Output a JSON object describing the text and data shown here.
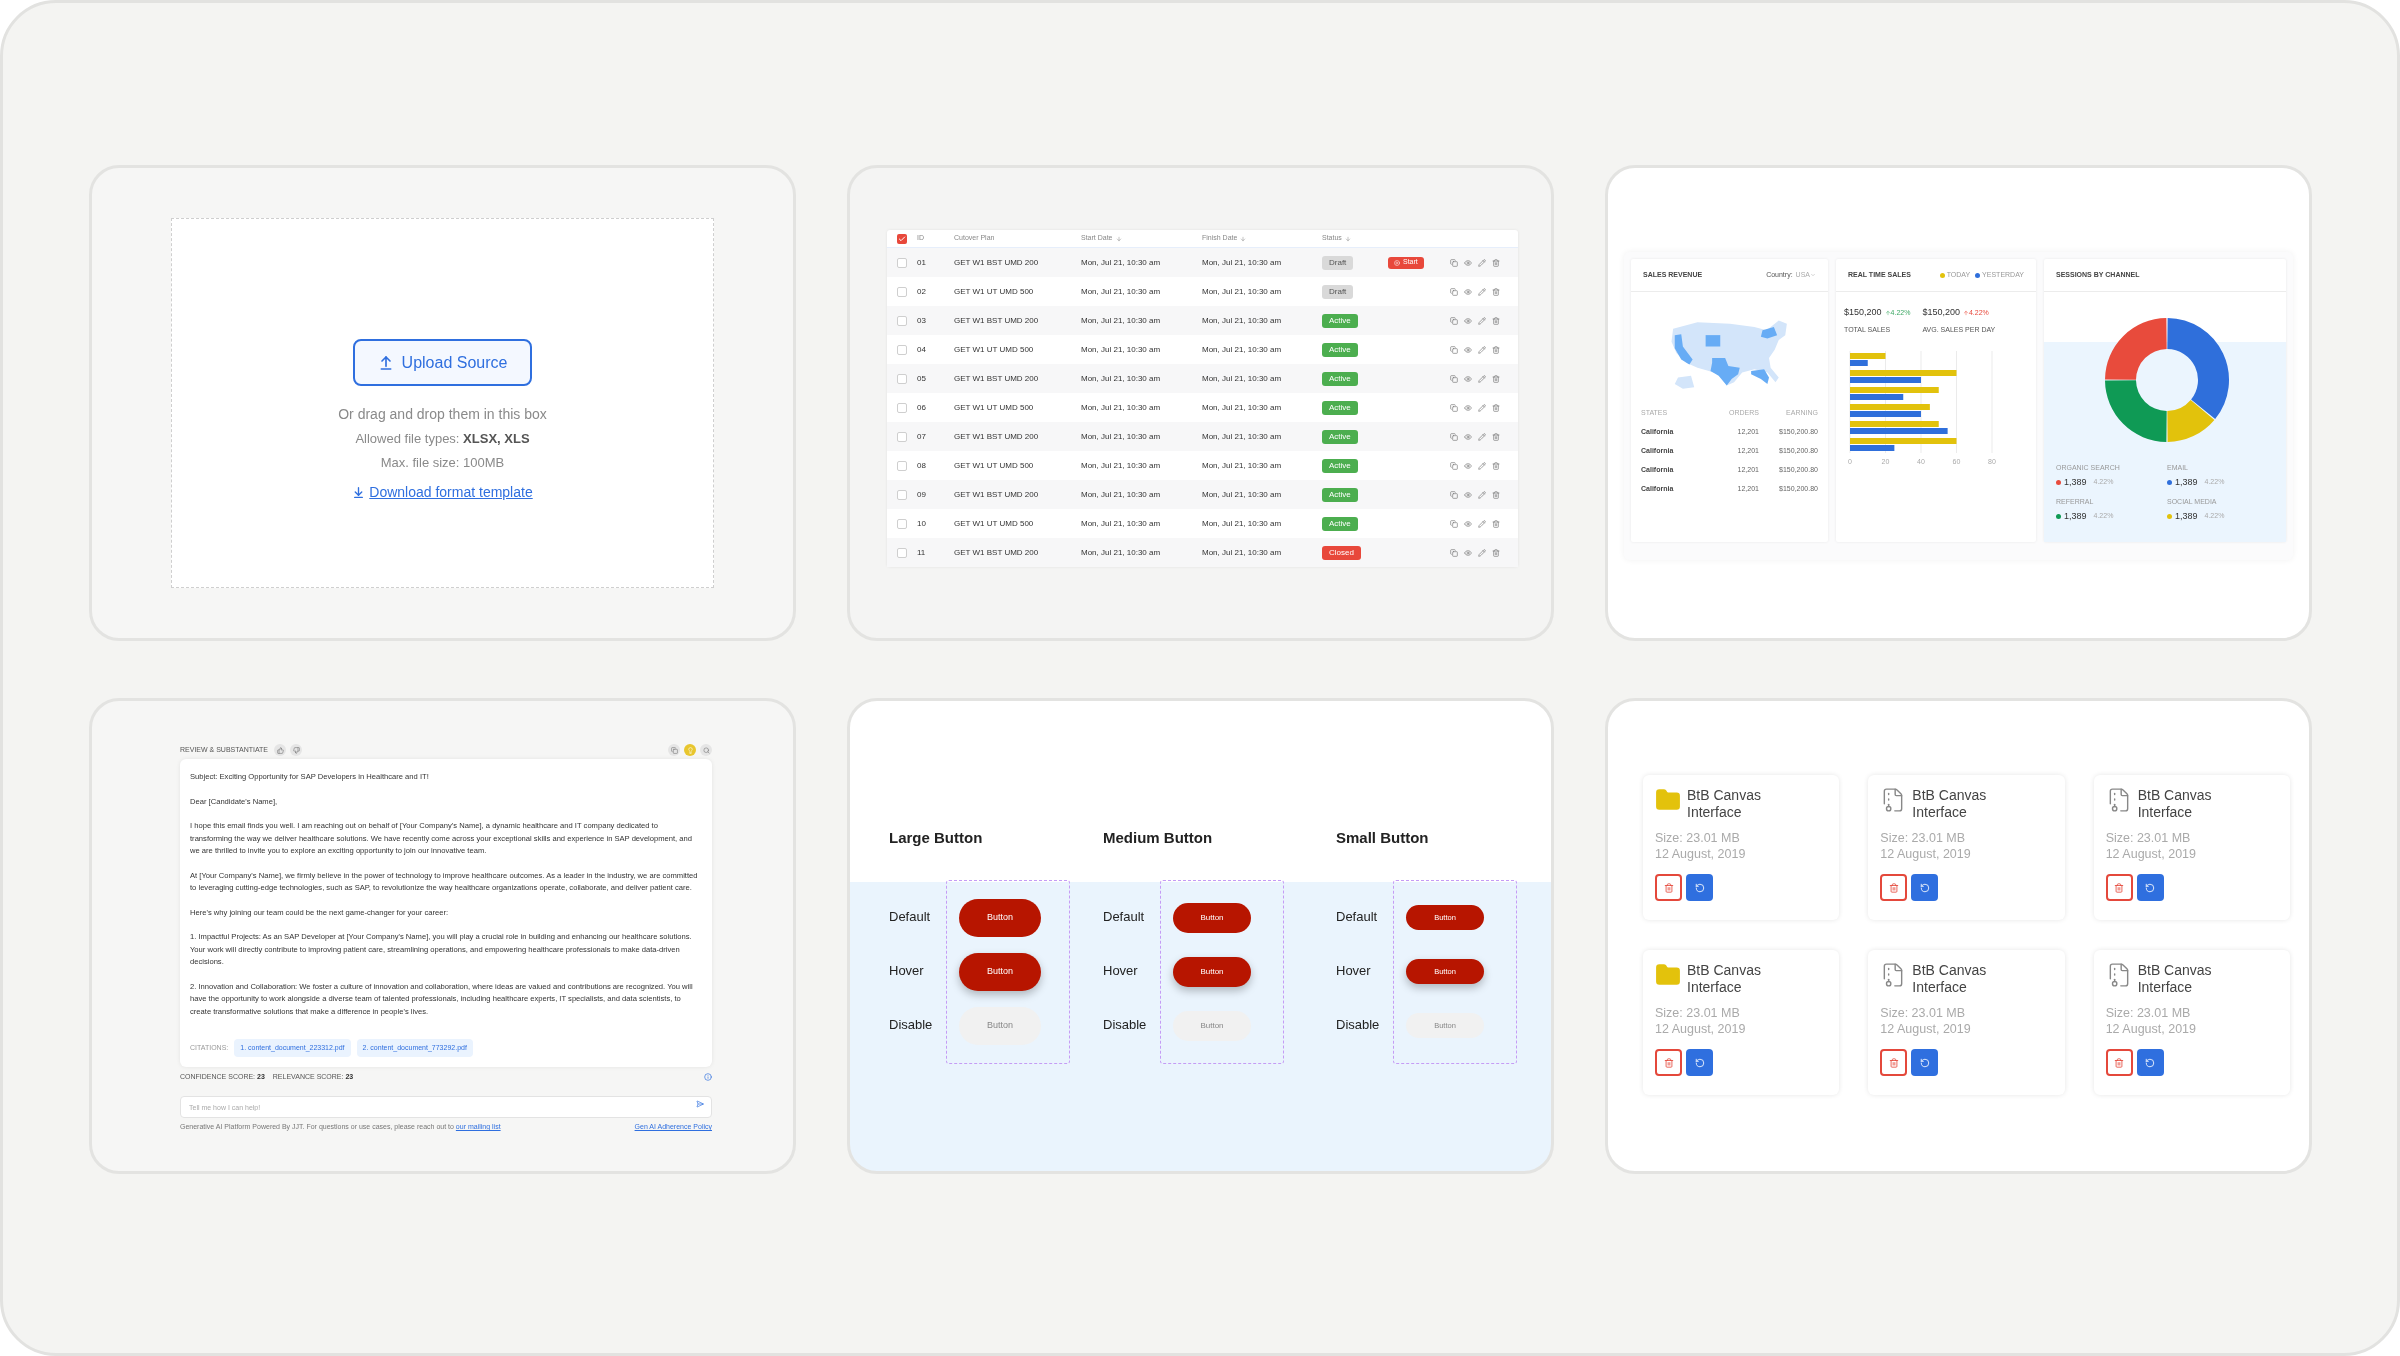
{
  "upload": {
    "button": "Upload Source",
    "hint": "Or drag and drop them in this box",
    "types": "Allowed file types: **XLSX, XLS**",
    "size": "Max. file size: 100MB",
    "link": "Download format template"
  },
  "table": {
    "header_checked": true,
    "columns": [
      {
        "label": "ID",
        "sortable": false
      },
      {
        "label": "Cutover Plan",
        "sortable": false
      },
      {
        "label": "Start Date",
        "sortable": true
      },
      {
        "label": "Finish Date",
        "sortable": true
      },
      {
        "label": "Status",
        "sortable": true
      }
    ],
    "rows": [
      {
        "checked": false,
        "id": "01",
        "plan": "GET W1 BST UMD 200",
        "start": "Mon, Jul 21, 10:30 am",
        "finish": "Mon, Jul 21, 10:30 am",
        "status": "Draft",
        "color": "#d9d9d9",
        "action": "Start"
      },
      {
        "checked": false,
        "id": "02",
        "plan": "GET W1 UT UMD 500",
        "start": "Mon, Jul 21, 10:30 am",
        "finish": "Mon, Jul 21, 10:30 am",
        "status": "Draft",
        "color": "#d9d9d9"
      },
      {
        "checked": false,
        "id": "03",
        "plan": "GET W1 BST UMD 200",
        "start": "Mon, Jul 21, 10:30 am",
        "finish": "Mon, Jul 21, 10:30 am",
        "status": "Active",
        "color": "#4cae4f"
      },
      {
        "checked": false,
        "id": "04",
        "plan": "GET W1 UT UMD 500",
        "start": "Mon, Jul 21, 10:30 am",
        "finish": "Mon, Jul 21, 10:30 am",
        "status": "Active",
        "color": "#4cae4f"
      },
      {
        "checked": false,
        "id": "05",
        "plan": "GET W1 BST UMD 200",
        "start": "Mon, Jul 21, 10:30 am",
        "finish": "Mon, Jul 21, 10:30 am",
        "status": "Active",
        "color": "#4cae4f"
      },
      {
        "checked": false,
        "id": "06",
        "plan": "GET W1 UT UMD 500",
        "start": "Mon, Jul 21, 10:30 am",
        "finish": "Mon, Jul 21, 10:30 am",
        "status": "Active",
        "color": "#4cae4f"
      },
      {
        "checked": false,
        "id": "07",
        "plan": "GET W1 BST UMD 200",
        "start": "Mon, Jul 21, 10:30 am",
        "finish": "Mon, Jul 21, 10:30 am",
        "status": "Active",
        "color": "#4cae4f"
      },
      {
        "checked": false,
        "id": "08",
        "plan": "GET W1 UT UMD 500",
        "start": "Mon, Jul 21, 10:30 am",
        "finish": "Mon, Jul 21, 10:30 am",
        "status": "Active",
        "color": "#4cae4f"
      },
      {
        "checked": false,
        "id": "09",
        "plan": "GET W1 BST UMD 200",
        "start": "Mon, Jul 21, 10:30 am",
        "finish": "Mon, Jul 21, 10:30 am",
        "status": "Active",
        "color": "#4cae4f"
      },
      {
        "checked": false,
        "id": "10",
        "plan": "GET W1 UT UMD 500",
        "start": "Mon, Jul 21, 10:30 am",
        "finish": "Mon, Jul 21, 10:30 am",
        "status": "Active",
        "color": "#4cae4f"
      },
      {
        "checked": false,
        "id": "11",
        "plan": "GET W1 BST UMD 200",
        "start": "Mon, Jul 21, 10:30 am",
        "finish": "Mon, Jul 21, 10:30 am",
        "status": "Closed",
        "color": "#e8483b"
      }
    ]
  },
  "dashboard": {
    "sales_revenue": {
      "title": "SALES REVENUE",
      "country_label": "Country:",
      "country": "USA",
      "columns": [
        "STATES",
        "ORDERS",
        "EARNING"
      ],
      "rows": [
        {
          "state": "California",
          "orders": "12,201",
          "earning": "$150,200.80"
        },
        {
          "state": "California",
          "orders": "12,201",
          "earning": "$150,200.80"
        },
        {
          "state": "California",
          "orders": "12,201",
          "earning": "$150,200.80"
        },
        {
          "state": "California",
          "orders": "12,201",
          "earning": "$150,200.80"
        }
      ]
    },
    "real_time_sales": {
      "title": "REAL TIME SALES",
      "stats": [
        {
          "value": "$150,200",
          "change": "4.22%",
          "positive": true,
          "label": "TOTAL SALES"
        },
        {
          "value": "$150,200",
          "change": "4.22%",
          "positive": false,
          "label": "AVG. SALES PER DAY"
        }
      ],
      "chart_data": {
        "type": "bar",
        "orientation": "horizontal",
        "grid": true,
        "xlim": [
          0,
          80
        ],
        "xticks": [
          0,
          20,
          40,
          60,
          80
        ],
        "series": [
          {
            "name": "TODAY",
            "color": "#e2c20c",
            "values": [
              20,
              60,
              50,
              45,
              50,
              60
            ]
          },
          {
            "name": "YESTERDAY",
            "color": "#2f6fdb",
            "values": [
              10,
              40,
              30,
              40,
              55,
              25
            ]
          }
        ]
      }
    },
    "sessions": {
      "title": "SESSIONS BY CHANNEL",
      "channels": [
        {
          "label": "ORGANIC SEARCH",
          "value": "1,389",
          "change": "4.22%",
          "color": "#e84b3c"
        },
        {
          "label": "EMAIL",
          "value": "1,389",
          "change": "4.22%",
          "color": "#2f6fdb"
        },
        {
          "label": "REFERRAL",
          "value": "1,389",
          "change": "4.22%",
          "color": "#0f9a55"
        },
        {
          "label": "SOCIAL MEDIA",
          "value": "1,389",
          "change": "4.22%",
          "color": "#e2c20c"
        }
      ]
    }
  },
  "assistant": {
    "title": "REVIEW & SUBSTANTIATE",
    "paragraphs": [
      "Subject: Exciting Opportunity for SAP Developers in Healthcare and IT!",
      "Dear [Candidate's Name],",
      "I hope this email finds you well. I am reaching out on behalf of [Your Company's Name], a dynamic healthcare and IT company dedicated to transforming the way we deliver healthcare solutions. We have recently come across your exceptional skills and experience in SAP development, and we are thrilled to invite you to explore an exciting opportunity to join our innovative team.",
      "At [Your Company's Name], we firmly believe in the power of technology to improve healthcare outcomes. As a leader in the industry, we are committed to leveraging cutting-edge technologies, such as SAP, to revolutionize the way healthcare organizations operate, collaborate, and deliver patient care.",
      "Here's why joining our team could be the next game-changer for your career:",
      "1. Impactful Projects: As an SAP Developer at [Your Company's Name], you will play a crucial role in building and enhancing our healthcare solutions. Your work will directly contribute to improving patient care, streamlining operations, and empowering healthcare professionals to make data-driven decisions.",
      "2. Innovation and Collaboration: We foster a culture of innovation and collaboration, where ideas are valued and contributions are recognized. You will have the opportunity to work alongside a diverse team of talented professionals, including healthcare experts, IT specialists, and data scientists, to create transformative solutions that make a difference in people's lives."
    ],
    "citations_label": "CITATIONS:",
    "citations": [
      "1. content_document_223312.pdf",
      "2. content_document_773292.pdf"
    ],
    "scores": [
      "CONFIDENCE SCORE: **23**",
      "RELEVANCE SCORE: **23**"
    ],
    "input": {
      "placeholder": "Tell me how I can help!"
    },
    "footer": "Generative AI Platform Powered By JJT. For questions or use cases, please reach out to ",
    "footer_link": "our mailing list",
    "policy_link": "Gen AI Adherence Policy"
  },
  "buttons": [
    {
      "title": "Large Button",
      "kind": "large",
      "rows": [
        {
          "label": "Default",
          "kind": "default",
          "button": "Button"
        },
        {
          "label": "Hover",
          "kind": "hover",
          "button": "Button"
        },
        {
          "label": "Disable",
          "kind": "disabled",
          "button": "Button"
        }
      ]
    },
    {
      "title": "Medium Button",
      "kind": "medium",
      "rows": [
        {
          "label": "Default",
          "kind": "default",
          "button": "Button"
        },
        {
          "label": "Hover",
          "kind": "hover",
          "button": "Button"
        },
        {
          "label": "Disable",
          "kind": "disabled",
          "button": "Button"
        }
      ]
    },
    {
      "title": "Small Button",
      "kind": "small",
      "rows": [
        {
          "label": "Default",
          "kind": "default",
          "button": "Button"
        },
        {
          "label": "Hover",
          "kind": "hover",
          "button": "Button"
        },
        {
          "label": "Disable",
          "kind": "disabled",
          "button": "Button"
        }
      ]
    }
  ],
  "files": [
    {
      "kind": "folder",
      "name": "BtB Canvas Interface",
      "size": "Size: 23.01 MB",
      "date": "12 August, 2019"
    },
    {
      "kind": "archive",
      "name": "BtB Canvas Interface",
      "size": "Size: 23.01 MB",
      "date": "12 August, 2019"
    },
    {
      "kind": "archive",
      "name": "BtB Canvas Interface",
      "size": "Size: 23.01 MB",
      "date": "12 August, 2019"
    },
    {
      "kind": "folder",
      "name": "BtB Canvas Interface",
      "size": "Size: 23.01 MB",
      "date": "12 August, 2019"
    },
    {
      "kind": "archive",
      "name": "BtB Canvas Interface",
      "size": "Size: 23.01 MB",
      "date": "12 August, 2019"
    },
    {
      "kind": "archive",
      "name": "BtB Canvas Interface",
      "size": "Size: 23.01 MB",
      "date": "12 August, 2019"
    }
  ]
}
